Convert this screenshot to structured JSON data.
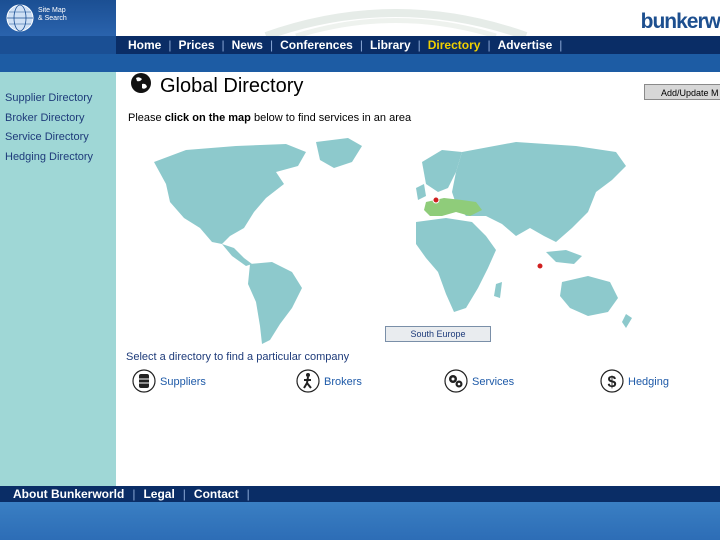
{
  "header": {
    "sitemap_line1": "Site Map",
    "sitemap_line2": "& Search",
    "brand": "bunkerw"
  },
  "nav": {
    "items": [
      "Home",
      "Prices",
      "News",
      "Conferences",
      "Library",
      "Directory",
      "Advertise"
    ],
    "active": "Directory",
    "active_color": "#f0d000"
  },
  "sidebar": {
    "items": [
      "Supplier Directory",
      "Broker Directory",
      "Service Directory",
      "Hedging Directory"
    ]
  },
  "main": {
    "title": "Global Directory",
    "add_button": "Add/Update M",
    "instruction_pre": "Please ",
    "instruction_bold": "click on the map",
    "instruction_post": " below to find services in an area",
    "region_label": "South Europe",
    "select_text": "Select a directory to find a particular company"
  },
  "directories": {
    "suppliers": "Suppliers",
    "brokers": "Brokers",
    "services": "Services",
    "hedging": "Hedging"
  },
  "footer": {
    "items": [
      "About Bunkerworld",
      "Legal",
      "Contact"
    ]
  },
  "colors": {
    "map_land": "#8dc9cc",
    "highlight": "#8fcc7a",
    "sidebar": "#9fd7d6"
  }
}
